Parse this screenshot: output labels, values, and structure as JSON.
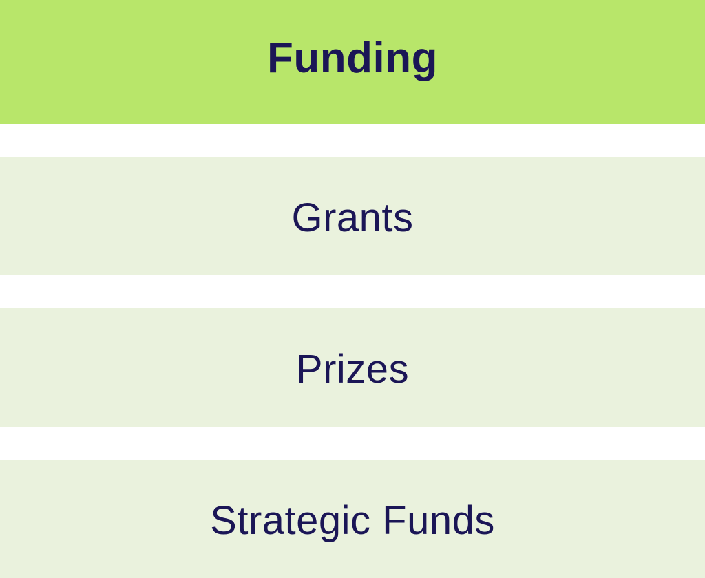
{
  "header": {
    "title": "Funding",
    "background_color": "#b8e66a"
  },
  "menu": {
    "items": [
      {
        "label": "Grants"
      },
      {
        "label": "Prizes"
      },
      {
        "label": "Strategic Funds"
      }
    ],
    "item_background_color": "#eaf2dd",
    "text_color": "#1b1656"
  }
}
